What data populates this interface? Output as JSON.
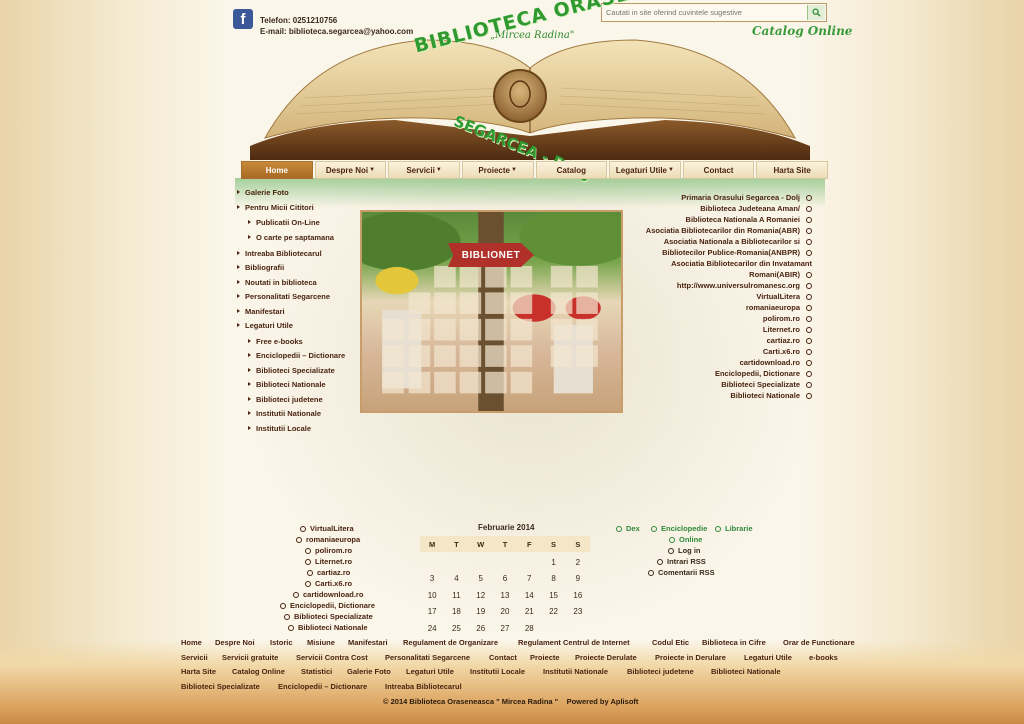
{
  "header": {
    "phone": "Telefon: 0251210756",
    "email": "E-mail: biblioteca.segarcea@yahoo.com",
    "search_placeholder": "Cautati in site oferind cuvintele sugestive",
    "catalog_online": "Catalog Online",
    "logo_title": "BIBLIOTECA ORASENEASCA",
    "logo_subtitle": "„Mircea Radina\"",
    "logo_city": "SEGARCEA - DOLJ",
    "facebook_icon": "facebook-icon"
  },
  "nav": [
    {
      "label": "Home",
      "active": true,
      "dropdown": false
    },
    {
      "label": "Despre Noi",
      "dropdown": true
    },
    {
      "label": "Servicii",
      "dropdown": true
    },
    {
      "label": "Proiecte",
      "dropdown": true
    },
    {
      "label": "Catalog",
      "dropdown": false
    },
    {
      "label": "Legaturi Utile",
      "dropdown": true
    },
    {
      "label": "Contact",
      "dropdown": false
    },
    {
      "label": "Harta Site",
      "dropdown": false
    }
  ],
  "left_menu": [
    {
      "label": "Galerie Foto",
      "sub": false
    },
    {
      "label": "Pentru Micii Cititori",
      "sub": false
    },
    {
      "label": "Publicatii On-Line",
      "sub": true
    },
    {
      "label": "O carte pe saptamana",
      "sub": true
    },
    {
      "label": "Intreaba Bibliotecarul",
      "sub": false
    },
    {
      "label": "Bibliografii",
      "sub": false
    },
    {
      "label": "Noutati in biblioteca",
      "sub": false
    },
    {
      "label": "Personalitati Segarcene",
      "sub": false
    },
    {
      "label": "Manifestari",
      "sub": false
    },
    {
      "label": "Legaturi Utile",
      "sub": false
    },
    {
      "label": "Free e-books",
      "sub": true
    },
    {
      "label": "Enciclopedii – Dictionare",
      "sub": true
    },
    {
      "label": "Biblioteci Specializate",
      "sub": true
    },
    {
      "label": "Biblioteci Nationale",
      "sub": true
    },
    {
      "label": "Biblioteci judetene",
      "sub": true
    },
    {
      "label": "Institutii Nationale",
      "sub": true
    },
    {
      "label": "Institutii Locale",
      "sub": true
    }
  ],
  "photo": {
    "sign_text": "BIBLIONET"
  },
  "right_links": [
    "Primaria Orasului Segarcea - Dolj",
    "Biblioteca Judeteana Aman/",
    "Biblioteca Nationala A Romaniei",
    "Asociatia Bibliotecarilor din Romania(ABR)",
    "Asociatia Nationala a Bibliotecarilor si",
    "Bibliotecilor Publice-Romania(ANBPR)",
    "Asociatia Bibliotecarilor din Invatamant",
    "Romani(ABIR)",
    "http://www.universulromanesc.org",
    "VirtualLitera",
    "romaniaeuropa",
    "polirom.ro",
    "Liternet.ro",
    "cartiaz.ro",
    "Carti.x6.ro",
    "cartidownload.ro",
    "Enciclopedii, Dictionare",
    "Biblioteci Specializate",
    "Biblioteci Nationale"
  ],
  "bottom_left_links": [
    "VirtualLitera",
    "romaniaeuropa",
    "polirom.ro",
    "Liternet.ro",
    "cartiaz.ro",
    "Carti.x6.ro",
    "cartidownload.ro",
    "Enciclopedii, Dictionare",
    "Biblioteci Specializate",
    "Biblioteci Nationale"
  ],
  "calendar": {
    "title": "Februarie 2014",
    "days": [
      "M",
      "T",
      "W",
      "T",
      "F",
      "S",
      "S"
    ],
    "weeks": [
      [
        "",
        "",
        "",
        "",
        "",
        "1",
        "2"
      ],
      [
        "3",
        "4",
        "5",
        "6",
        "7",
        "8",
        "9"
      ],
      [
        "10",
        "11",
        "12",
        "13",
        "14",
        "15",
        "16"
      ],
      [
        "17",
        "18",
        "19",
        "20",
        "21",
        "22",
        "23"
      ],
      [
        "24",
        "25",
        "26",
        "27",
        "28",
        "",
        ""
      ]
    ]
  },
  "right_bottom": {
    "tabs": [
      "Dex",
      "Enciclopedie",
      "Librarie"
    ],
    "online": "Online",
    "meta": [
      "Log in",
      "Intrari RSS",
      "Comentarii RSS"
    ]
  },
  "footer": {
    "rows": [
      [
        "Home",
        "Despre Noi",
        "Istoric",
        "Misiune",
        "Manifestari",
        "Regulament de Organizare",
        "Regulament Centrul de Internet",
        "Codul Etic",
        "Biblioteca in Cifre",
        "Orar de Functionare"
      ],
      [
        "Servicii",
        "Servicii gratuite",
        "Servicii Contra Cost",
        "Personalitati Segarcene",
        "Contact",
        "Proiecte",
        "Proiecte Derulate",
        "Proiecte in Derulare",
        "Legaturi Utile",
        "e-books"
      ],
      [
        "Harta Site",
        "Catalog Online",
        "Statistici",
        "Galerie Foto",
        "Legaturi Utile",
        "Institutii Locale",
        "Institutii Nationale",
        "Biblioteci judetene",
        "Biblioteci Nationale"
      ],
      [
        "Biblioteci Specializate",
        "Enciclopedii – Dictionare",
        "Intreaba Bibliotecarul"
      ]
    ],
    "copyright": "© 2014 Biblioteca Oraseneasca \" Mircea Radina \"",
    "powered": "Powered by Aplisoft"
  }
}
